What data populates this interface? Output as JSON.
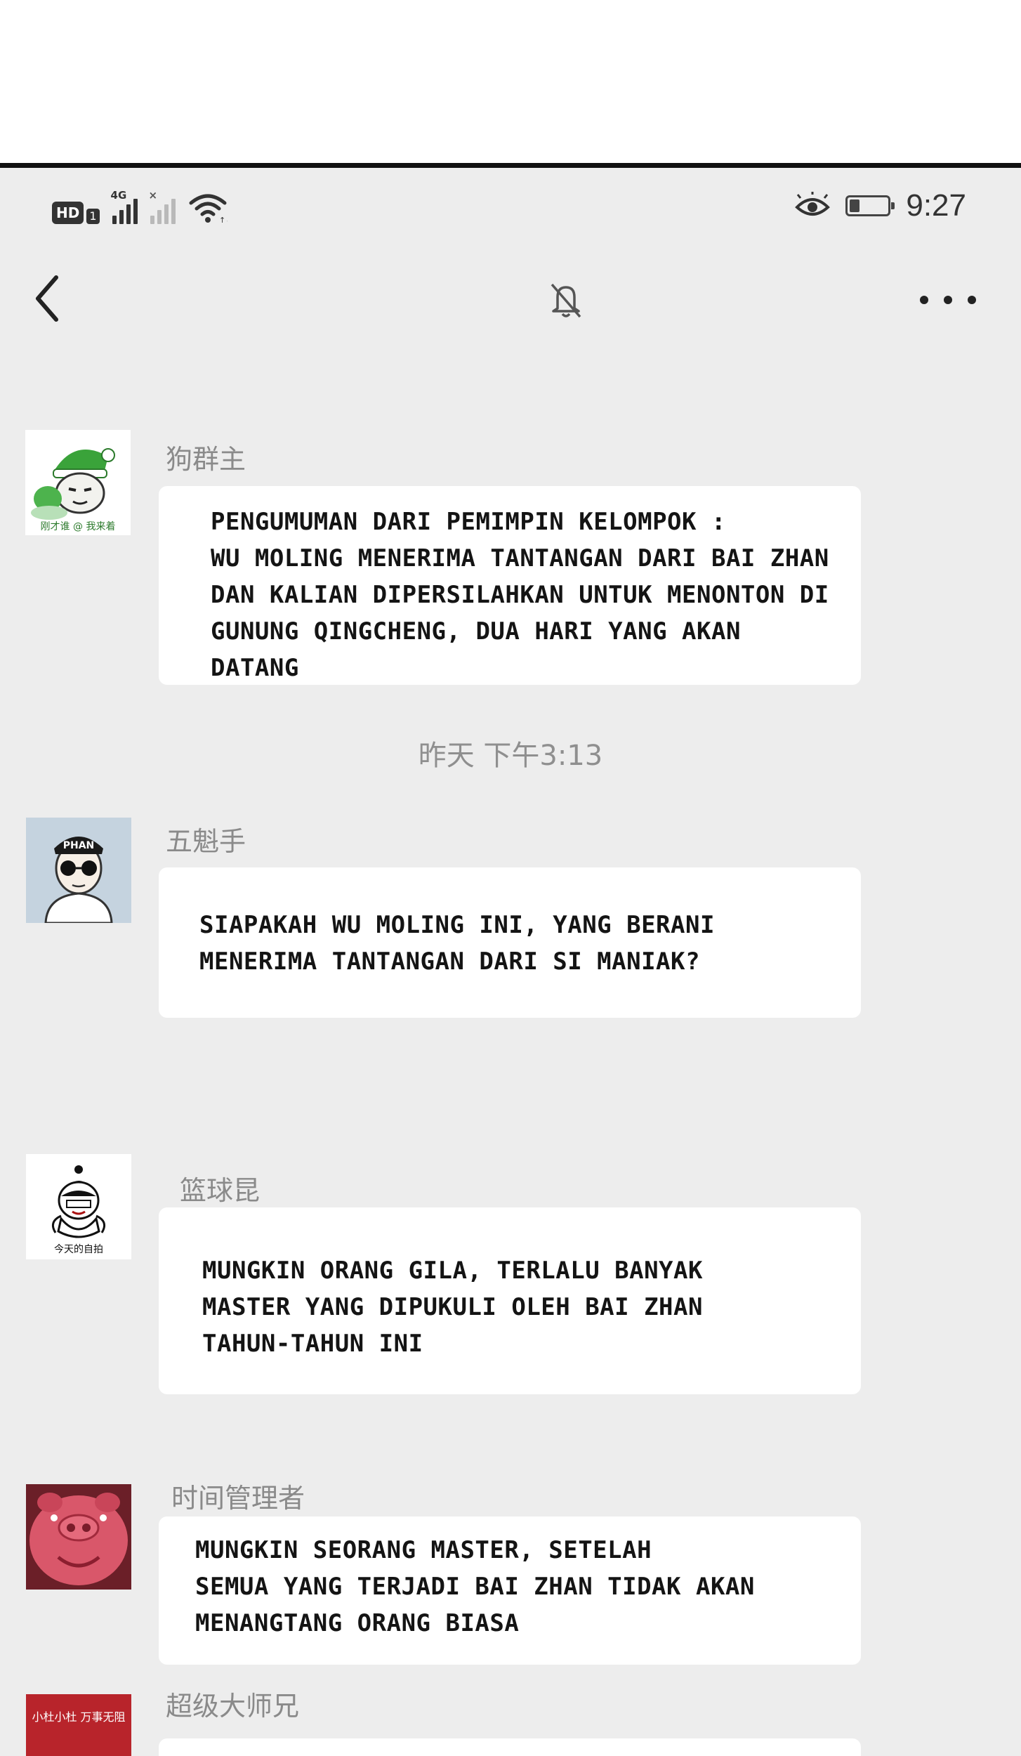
{
  "status_bar": {
    "hd_label": "HD",
    "sim_label": "1",
    "network_label": "4G",
    "sim2_label": "×",
    "time": "9:27"
  },
  "nav": {
    "back_icon": "chevron-left-icon",
    "mute_icon": "bell-muted-icon",
    "more_icon": "more-dots-icon"
  },
  "timestamp": "昨天 下午3:13",
  "messages": [
    {
      "sender": "狗群主",
      "avatar_caption": "刚才谁 @ 我来着",
      "lines": [
        "PENGUMUMAN DARI PEMIMPIN KELOMPOK :",
        "WU MOLING MENERIMA TANTANGAN DARI BAI ZHAN",
        "DAN KALIAN DIPERSILAHKAN UNTUK MENONTON DI",
        "GUNUNG QINGCHENG, DUA HARI YANG AKAN",
        "DATANG"
      ]
    },
    {
      "sender": "五魁手",
      "avatar_caption": "PHAN",
      "lines": [
        "SIAPAKAH WU MOLING INI, YANG BERANI",
        "MENERIMA TANTANGAN DARI SI MANIAK?"
      ]
    },
    {
      "sender": "篮球昆",
      "avatar_caption": "今天的自拍",
      "lines": [
        "MUNGKIN ORANG GILA, TERLALU BANYAK",
        "MASTER YANG DIPUKULI OLEH BAI ZHAN",
        "TAHUN-TAHUN INI"
      ]
    },
    {
      "sender": "时间管理者",
      "lines": [
        "MUNGKIN SEORANG MASTER, SETELAH",
        "SEMUA YANG TERJADI BAI ZHAN TIDAK AKAN",
        "MENANGTANG ORANG BIASA"
      ]
    },
    {
      "sender": "超级大师兄",
      "avatar_caption": "小杜小杜 万事无阻"
    }
  ],
  "colors": {
    "chat_background": "#ededed",
    "bubble": "#ffffff",
    "sender_name": "#8a8a8a",
    "text": "#141414"
  }
}
